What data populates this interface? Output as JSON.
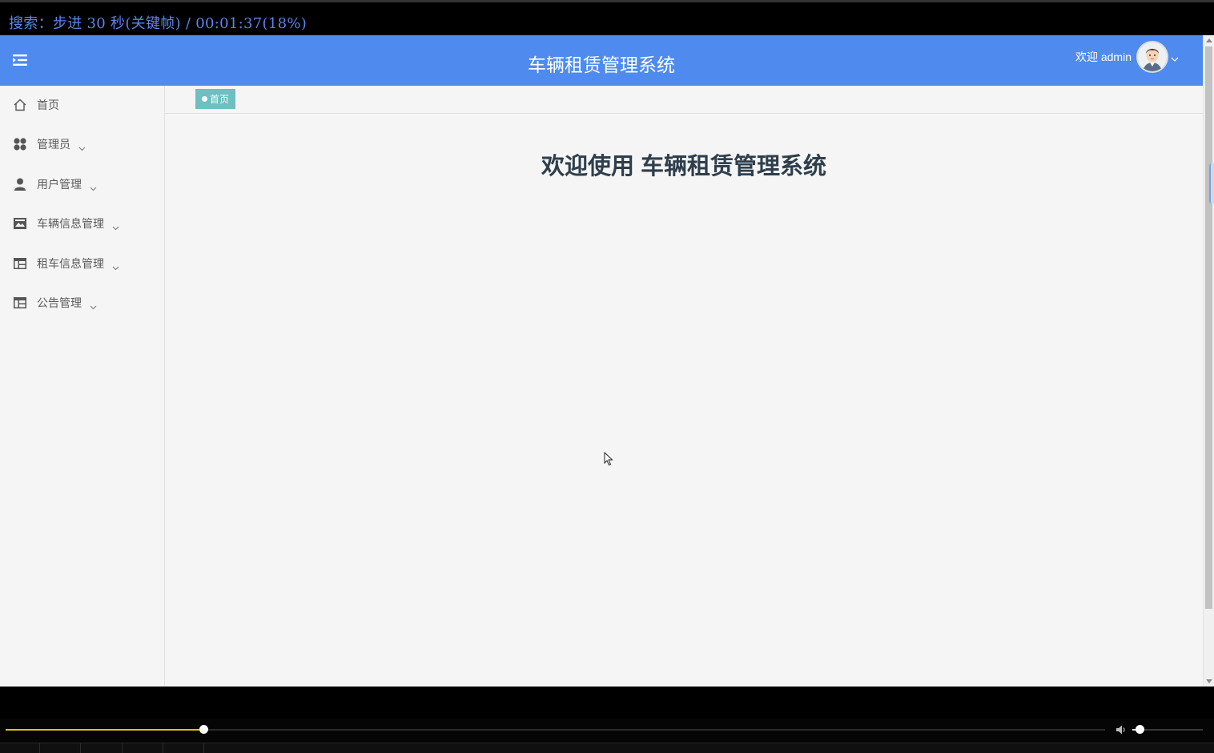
{
  "player": {
    "osd_text": "搜索：步进 30 秒(关键帧) / 00:01:37(18%)",
    "seek_progress_fraction": 0.18,
    "volume_fraction": 0.1,
    "accent_color": "#e1c300",
    "osd_color": "#5b86e8"
  },
  "header": {
    "title": "车辆租赁管理系统",
    "welcome": "欢迎 admin",
    "menu_icon": "menu-fold-icon",
    "user_caret_icon": "chevron-down-icon",
    "background_color": "#4f8aee"
  },
  "sidebar": {
    "items": [
      {
        "label": "首页",
        "icon": "home-icon",
        "has_submenu": false
      },
      {
        "label": "管理员",
        "icon": "grid-icon",
        "has_submenu": true
      },
      {
        "label": "用户管理",
        "icon": "user-icon",
        "has_submenu": true
      },
      {
        "label": "车辆信息管理",
        "icon": "store-icon",
        "has_submenu": true
      },
      {
        "label": "租车信息管理",
        "icon": "table-icon",
        "has_submenu": true
      },
      {
        "label": "公告管理",
        "icon": "table-icon",
        "has_submenu": true
      }
    ]
  },
  "tabs": [
    {
      "label": "首页",
      "active": true,
      "color": "#6cc0c0"
    }
  ],
  "main": {
    "heading": "欢迎使用 车辆租赁管理系统"
  }
}
